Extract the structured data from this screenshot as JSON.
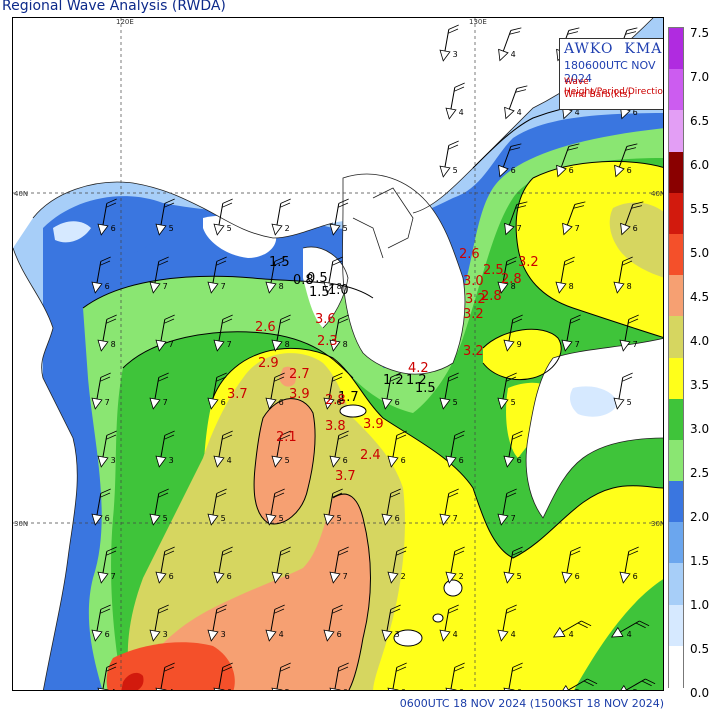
{
  "title": "Regional Wave Analysis (RWDA)",
  "infobox": {
    "agency_left": "AWKO",
    "agency_right": "KMA",
    "valid_time": "180600UTC NOV 2024",
    "line1": "Wave Height/Period/Direction",
    "line2": "Wind Barb(kts)"
  },
  "footer": "0600UTC 18 NOV 2024 (1500KST 18 NOV 2024)",
  "axes": {
    "lon_top": [
      "120E",
      "130E"
    ],
    "lat_left": [
      "40N",
      "30N"
    ],
    "lat_right": [
      "40N",
      "30N"
    ]
  },
  "legend": {
    "labels": [
      "7.5",
      "7.0",
      "6.5",
      "6.0",
      "5.5",
      "5.0",
      "4.5",
      "4.0",
      "3.5",
      "3.0",
      "2.5",
      "2.0",
      "1.5",
      "1.0",
      "0.5",
      "0.0"
    ],
    "colors": [
      "#b02be0",
      "#cc5cf0",
      "#e39ef5",
      "#8a0000",
      "#d21a0d",
      "#f4502a",
      "#f6a072",
      "#d6d660",
      "#ffff1a",
      "#3fc43a",
      "#8ae672",
      "#3a76e0",
      "#6ba6ee",
      "#a7cef8",
      "#d6e9ff",
      "#ffffff"
    ]
  },
  "wave_heights": [
    {
      "v": "1.5",
      "c": "#000"
    },
    {
      "v": "0.5",
      "c": "#000"
    },
    {
      "v": "0.8",
      "c": "#000"
    },
    {
      "v": "1.5",
      "c": "#000"
    },
    {
      "v": "1.0",
      "c": "#000"
    },
    {
      "v": "1.7",
      "c": "#000"
    },
    {
      "v": "1.2",
      "c": "#000"
    },
    {
      "v": "1.2",
      "c": "#000"
    },
    {
      "v": "1.5",
      "c": "#000"
    },
    {
      "v": "2.6",
      "c": "#c00"
    },
    {
      "v": "3.0",
      "c": "#c00"
    },
    {
      "v": "2.5",
      "c": "#c00"
    },
    {
      "v": "3.2",
      "c": "#c00"
    },
    {
      "v": "2.8",
      "c": "#c00"
    },
    {
      "v": "3.2",
      "c": "#c00"
    },
    {
      "v": "2.8",
      "c": "#c00"
    },
    {
      "v": "3.2",
      "c": "#c00"
    },
    {
      "v": "3.2",
      "c": "#c00"
    },
    {
      "v": "2.6",
      "c": "#c00"
    },
    {
      "v": "2.9",
      "c": "#c00"
    },
    {
      "v": "3.6",
      "c": "#c00"
    },
    {
      "v": "2.3",
      "c": "#c00"
    },
    {
      "v": "2.7",
      "c": "#c00"
    },
    {
      "v": "3.9",
      "c": "#c00"
    },
    {
      "v": "3.7",
      "c": "#c00"
    },
    {
      "v": "2.8",
      "c": "#c00"
    },
    {
      "v": "2.1",
      "c": "#c00"
    },
    {
      "v": "3.8",
      "c": "#c00"
    },
    {
      "v": "3.9",
      "c": "#c00"
    },
    {
      "v": "2.4",
      "c": "#c00"
    },
    {
      "v": "3.7",
      "c": "#c00"
    },
    {
      "v": "4.2",
      "c": "#c00"
    }
  ],
  "periods": [
    "3",
    "4",
    "4",
    "4",
    "4",
    "4",
    "4",
    "6",
    "5",
    "6",
    "6",
    "6",
    "6",
    "5",
    "5",
    "2",
    "5",
    "7",
    "7",
    "6",
    "6",
    "7",
    "7",
    "8",
    "8",
    "8",
    "8",
    "8",
    "8",
    "7",
    "7",
    "8",
    "8",
    "9",
    "7",
    "7",
    "7",
    "7",
    "6",
    "6",
    "6",
    "6",
    "5",
    "5",
    "5",
    "3",
    "3",
    "4",
    "5",
    "6",
    "6",
    "6",
    "6",
    "6",
    "5",
    "5",
    "5",
    "5",
    "6",
    "7",
    "7",
    "7",
    "6",
    "6",
    "6",
    "7",
    "2",
    "2",
    "5",
    "6",
    "6",
    "6",
    "3",
    "3",
    "4",
    "6"
  ]
}
